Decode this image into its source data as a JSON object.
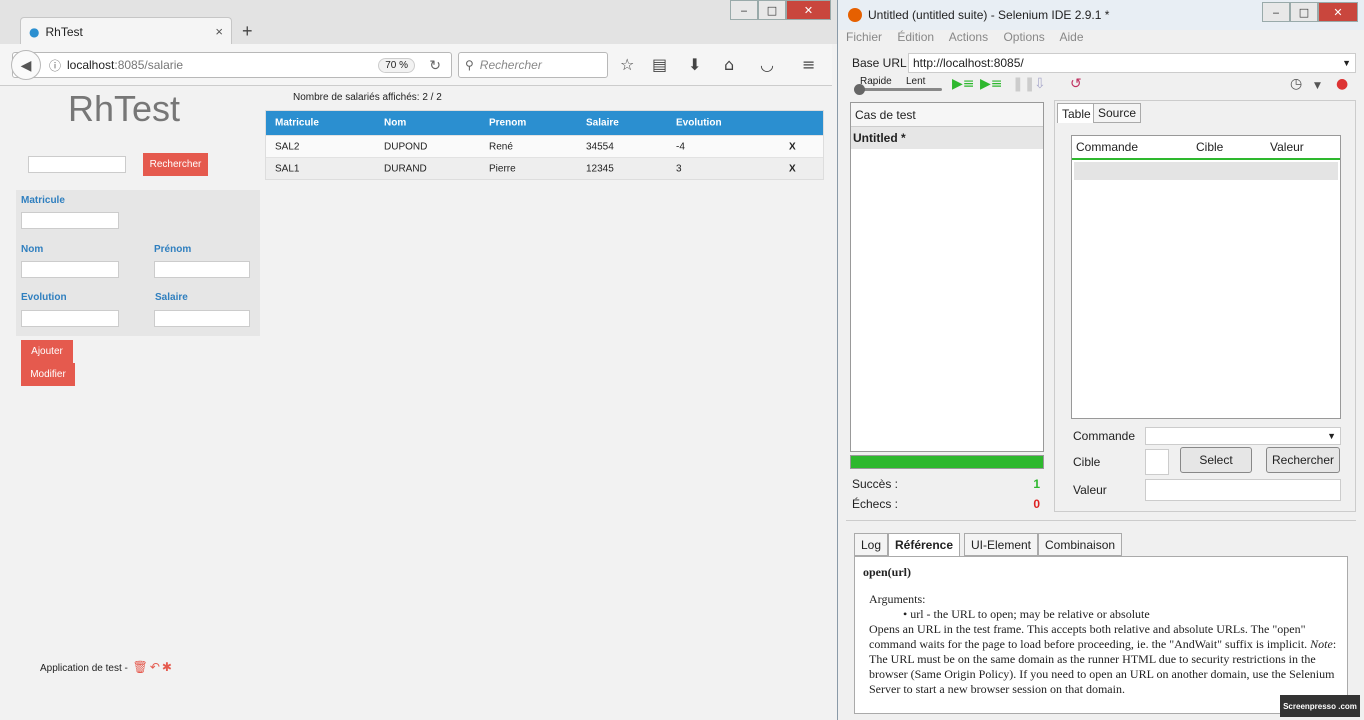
{
  "firefox": {
    "tab_title": "RhTest",
    "tab_close": "×",
    "new_tab": "+",
    "url_host": "localhost",
    "url_rest": ":8085/salarie",
    "zoom": "70 %",
    "search_placeholder": "Rechercher",
    "window_controls": [
      "‒",
      "□",
      "✕"
    ]
  },
  "app": {
    "title": "RhTest",
    "search_button": "Rechercher",
    "count_text": "Nombre de salariés affichés: 2 / 2",
    "form": {
      "matricule": "Matricule",
      "nom": "Nom",
      "prenom": "Prénom",
      "evolution": "Evolution",
      "salaire": "Salaire"
    },
    "add_button": "Ajouter",
    "modify_button": "Modifier",
    "table": {
      "headers": [
        "Matricule",
        "Nom",
        "Prenom",
        "Salaire",
        "Evolution"
      ],
      "rows": [
        {
          "matricule": "SAL2",
          "nom": "DUPOND",
          "prenom": "René",
          "salaire": "34554",
          "evolution": "-4",
          "del": "X"
        },
        {
          "matricule": "SAL1",
          "nom": "DURAND",
          "prenom": "Pierre",
          "salaire": "12345",
          "evolution": "3",
          "del": "X"
        }
      ]
    },
    "footer": "Application de test -"
  },
  "selenium": {
    "title": "Untitled (untitled suite) - Selenium IDE 2.9.1 *",
    "menu": [
      "Fichier",
      "Édition",
      "Actions",
      "Options",
      "Aide"
    ],
    "base_url_label": "Base URL",
    "base_url": "http://localhost:8085/",
    "speed_fast": "Rapide",
    "speed_slow": "Lent",
    "test_case_header": "Cas de test",
    "test_case_item": "Untitled *",
    "success_label": "Succès :",
    "success_value": "1",
    "fail_label": "Échecs :",
    "fail_value": "0",
    "tabs": [
      "Table",
      "Source"
    ],
    "columns": [
      "Commande",
      "Cible",
      "Valeur"
    ],
    "command_label": "Commande",
    "target_label": "Cible",
    "value_label": "Valeur",
    "select_button": "Select",
    "find_button": "Rechercher",
    "bottom_tabs": [
      "Log",
      "Référence",
      "UI-Element",
      "Combinaison"
    ],
    "ref_signature": "open(url)",
    "ref_arguments": "Arguments:",
    "ref_arg_item": "url - the URL to open; may be relative or absolute",
    "ref_description": "Opens an URL in the test frame. This accepts both relative and absolute URLs. The \"open\" command waits for the page to load before proceeding, ie. the \"AndWait\" suffix is implicit.",
    "ref_note_label": "Note",
    "ref_note": ": The URL must be on the same domain as the runner HTML due to security restrictions in the browser (Same Origin Policy). If you need to open an URL on another domain, use the Selenium Server to start a new browser session on that domain.",
    "watermark": "Screenpresso .com"
  },
  "colors": {
    "accent_blue": "#2b8fd0",
    "button_red": "#e55a4e",
    "success_green": "#2eb82e"
  }
}
